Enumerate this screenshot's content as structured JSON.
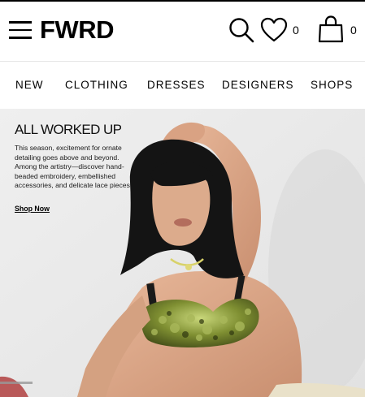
{
  "header": {
    "logo": "FWRD",
    "wishlist_count": "0",
    "bag_count": "0",
    "icons": {
      "menu": "hamburger-menu-icon",
      "search": "search-icon",
      "wishlist": "heart-icon",
      "bag": "shopping-bag-icon"
    }
  },
  "nav": {
    "items": [
      {
        "label": "NEW"
      },
      {
        "label": "CLOTHING"
      },
      {
        "label": "DRESSES"
      },
      {
        "label": "DESIGNERS"
      },
      {
        "label": "SHOPS"
      }
    ]
  },
  "hero": {
    "headline": "ALL WORKED UP",
    "body": "This season, excitement for ornate detailing goes above and beyond. Among the artistry—discover hand-beaded embroidery, embellished accessories, and delicate lace pieces.",
    "cta": "Shop Now"
  },
  "colors": {
    "background": "#ffffff",
    "text": "#000000",
    "hero_background": "#ebebeb",
    "top_accent": "#c9d77a"
  }
}
